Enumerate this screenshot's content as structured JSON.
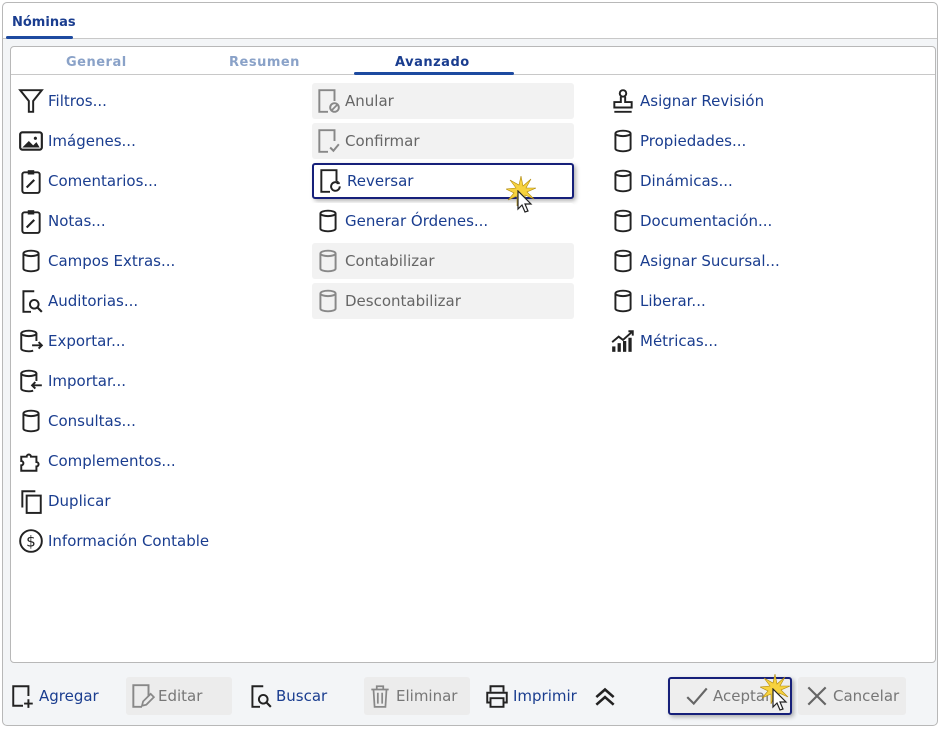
{
  "window": {
    "tab": "Nóminas"
  },
  "subtabs": [
    {
      "label": "General"
    },
    {
      "label": "Resumen"
    },
    {
      "label": "Avanzado",
      "active": true
    }
  ],
  "col1": [
    {
      "label": "Filtros...",
      "icon": "filter-icon"
    },
    {
      "label": "Imágenes...",
      "icon": "image-icon"
    },
    {
      "label": "Comentarios...",
      "icon": "clipboard-edit-icon"
    },
    {
      "label": "Notas...",
      "icon": "clipboard-edit-icon"
    },
    {
      "label": "Campos Extras...",
      "icon": "database-icon"
    },
    {
      "label": "Auditorias...",
      "icon": "audit-search-icon"
    },
    {
      "label": "Exportar...",
      "icon": "database-export-icon"
    },
    {
      "label": "Importar...",
      "icon": "database-import-icon"
    },
    {
      "label": "Consultas...",
      "icon": "database-icon"
    },
    {
      "label": "Complementos...",
      "icon": "puzzle-icon"
    },
    {
      "label": "Duplicar",
      "icon": "copy-icon"
    },
    {
      "label": "Información Contable",
      "icon": "dollar-icon"
    }
  ],
  "col2": [
    {
      "label": "Anular",
      "icon": "document-cancel-icon",
      "enabled": false
    },
    {
      "label": "Confirmar",
      "icon": "document-check-icon",
      "enabled": false
    },
    {
      "label": "Reversar",
      "icon": "document-revert-icon",
      "enabled": true
    },
    {
      "label": "Generar Órdenes...",
      "icon": "database-icon",
      "enabled": true
    },
    {
      "label": "Contabilizar",
      "icon": "database-icon",
      "enabled": false
    },
    {
      "label": "Descontabilizar",
      "icon": "database-icon",
      "enabled": false
    }
  ],
  "col3": [
    {
      "label": "Asignar Revisión",
      "icon": "stamp-icon"
    },
    {
      "label": "Propiedades...",
      "icon": "database-icon"
    },
    {
      "label": "Dinámicas...",
      "icon": "database-icon"
    },
    {
      "label": "Documentación...",
      "icon": "database-icon"
    },
    {
      "label": "Asignar Sucursal...",
      "icon": "database-icon"
    },
    {
      "label": "Liberar...",
      "icon": "database-icon"
    },
    {
      "label": "Métricas...",
      "icon": "chart-icon"
    }
  ],
  "toolbar": {
    "add": "Agregar",
    "edit": "Editar",
    "search": "Buscar",
    "delete": "Eliminar",
    "print": "Imprimir",
    "accept": "Aceptar",
    "cancel": "Cancelar"
  },
  "colors": {
    "accent": "#1a3d8f",
    "focus": "#16207a"
  }
}
